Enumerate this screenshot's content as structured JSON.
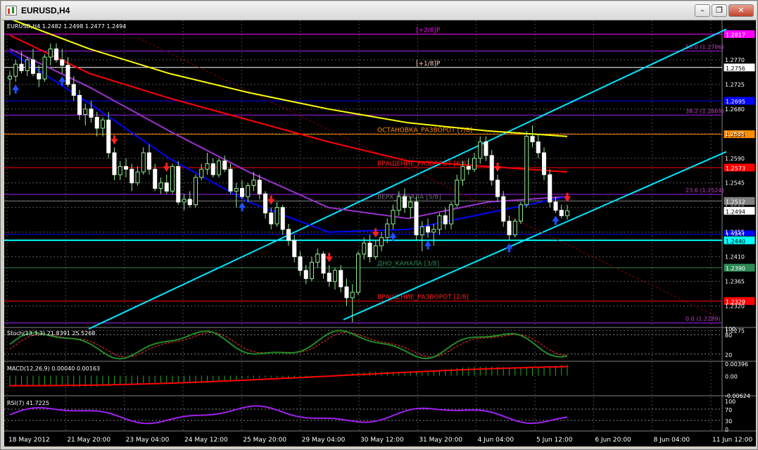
{
  "window": {
    "title": "EURUSD,H4",
    "minimize_label": "–",
    "restore_label": "❐",
    "close_label": "✕"
  },
  "chart_data": {
    "type": "candlestick",
    "symbol_header": "EURUSD,H4  1.2482 1.2498 1.2477 1.2494",
    "ylim": [
      1.2282,
      1.2842
    ],
    "y_ticks": [
      "1.2770",
      "1.2725",
      "1.2680",
      "1.2635",
      "1.2590",
      "1.2545",
      "1.2500",
      "1.2455",
      "1.2410",
      "1.2365",
      "1.2320",
      "1.2275"
    ],
    "x_ticks": [
      "18 May 2012",
      "21 May 20:00",
      "23 May 04:00",
      "24 May 12:00",
      "25 May 20:00",
      "29 May 04:00",
      "30 May 12:00",
      "31 May 20:00",
      "4 Jun 04:00",
      "5 Jun 12:00",
      "6 Jun 20:00",
      "8 Jun 04:00",
      "11 Jun 12:00"
    ],
    "levels": [
      {
        "price": 1.2817,
        "badge": "1.2817",
        "color": "#ff00ff",
        "label": "[+2/8]P",
        "label_color": "#ff00ff"
      },
      {
        "price": 1.2786,
        "badge": "",
        "color": "#a020f0",
        "label": "50.0 (1.2786)",
        "label_color": "#c040c0"
      },
      {
        "price": 1.2756,
        "badge": "1.2756",
        "color": "#ffffff",
        "label": "[+1/8]P",
        "label_color": "#ffd0c0"
      },
      {
        "price": 1.2695,
        "badge": "1.2695",
        "color": "#0000ff",
        "label": "",
        "label_color": "#0000ff"
      },
      {
        "price": 1.2669,
        "badge": "",
        "color": "#a020f0",
        "label": "38.2 (1.2669)",
        "label_color": "#c040c0"
      },
      {
        "price": 1.2634,
        "badge": "1.2634",
        "color": "#ff8c00",
        "label": "ОСТАНОВКА_РАЗВОРОТ [7/8]",
        "label_color": "#ff8c00"
      },
      {
        "price": 1.2573,
        "badge": "1.2573",
        "color": "#ff0000",
        "label": "ВРАЩЕНИЕ_РАЗВОРОТ [6/8]",
        "label_color": "#ff2020"
      },
      {
        "price": 1.2524,
        "badge": "",
        "color": "#a020f0",
        "label": "23.6 (1.2524)",
        "label_color": "#c040c0"
      },
      {
        "price": 1.2512,
        "badge": "1.2512",
        "color": "#808080",
        "label": "ВЕРХ_КАНАЛА [5/8]",
        "label_color": "#707070"
      },
      {
        "price": 1.2451,
        "badge": "1.2451",
        "color": "#0000ff",
        "label": "",
        "label_color": "#0000ff"
      },
      {
        "price": 1.244,
        "badge": "1.2440",
        "color": "#00ffff",
        "label": "",
        "label_color": "#00ffff"
      },
      {
        "price": 1.239,
        "badge": "1.2390",
        "color": "#2e8b57",
        "label": "ДНО_КАНАЛА [3/8]",
        "label_color": "#2e8b57"
      },
      {
        "price": 1.2329,
        "badge": "1.2329",
        "color": "#ff0000",
        "label": "ВРАЩЕНИЕ_РАЗВОРОТ [2/8]",
        "label_color": "#ff2020"
      },
      {
        "price": 1.2289,
        "badge": "",
        "color": "#a020f0",
        "label": "0.0 (1.2289)",
        "label_color": "#c040c0"
      }
    ],
    "current_price": "1.2494",
    "candles": [
      [
        1.2735,
        1.275,
        1.2705,
        1.274
      ],
      [
        1.274,
        1.277,
        1.273,
        1.2762
      ],
      [
        1.2762,
        1.2785,
        1.2745,
        1.275
      ],
      [
        1.275,
        1.2775,
        1.274,
        1.277
      ],
      [
        1.277,
        1.279,
        1.274,
        1.2745
      ],
      [
        1.2745,
        1.276,
        1.272,
        1.2735
      ],
      [
        1.2735,
        1.278,
        1.273,
        1.2775
      ],
      [
        1.2775,
        1.28,
        1.276,
        1.279
      ],
      [
        1.279,
        1.28,
        1.2765,
        1.277
      ],
      [
        1.277,
        1.279,
        1.2745,
        1.276
      ],
      [
        1.276,
        1.2775,
        1.272,
        1.2725
      ],
      [
        1.2725,
        1.274,
        1.2695,
        1.2705
      ],
      [
        1.2705,
        1.2715,
        1.266,
        1.267
      ],
      [
        1.267,
        1.269,
        1.265,
        1.268
      ],
      [
        1.268,
        1.2695,
        1.2655,
        1.2665
      ],
      [
        1.2665,
        1.2675,
        1.263,
        1.2645
      ],
      [
        1.2645,
        1.2665,
        1.263,
        1.266
      ],
      [
        1.266,
        1.2675,
        1.259,
        1.26
      ],
      [
        1.26,
        1.261,
        1.255,
        1.256
      ],
      [
        1.256,
        1.2585,
        1.255,
        1.2575
      ],
      [
        1.2575,
        1.259,
        1.2555,
        1.257
      ],
      [
        1.257,
        1.258,
        1.253,
        1.2545
      ],
      [
        1.2545,
        1.2575,
        1.254,
        1.2565
      ],
      [
        1.2565,
        1.261,
        1.256,
        1.26
      ],
      [
        1.26,
        1.2615,
        1.256,
        1.257
      ],
      [
        1.257,
        1.258,
        1.253,
        1.2535
      ],
      [
        1.2535,
        1.2555,
        1.2525,
        1.2545
      ],
      [
        1.2545,
        1.256,
        1.2525,
        1.253
      ],
      [
        1.253,
        1.258,
        1.2525,
        1.2575
      ],
      [
        1.2575,
        1.2585,
        1.2505,
        1.251
      ],
      [
        1.251,
        1.2525,
        1.2495,
        1.2515
      ],
      [
        1.2515,
        1.253,
        1.25,
        1.2505
      ],
      [
        1.2505,
        1.256,
        1.25,
        1.2555
      ],
      [
        1.2555,
        1.258,
        1.255,
        1.257
      ],
      [
        1.257,
        1.26,
        1.256,
        1.258
      ],
      [
        1.258,
        1.259,
        1.2555,
        1.256
      ],
      [
        1.256,
        1.259,
        1.2555,
        1.2585
      ],
      [
        1.2585,
        1.2595,
        1.2565,
        1.257
      ],
      [
        1.257,
        1.258,
        1.2525,
        1.253
      ],
      [
        1.253,
        1.2545,
        1.25,
        1.2535
      ],
      [
        1.2535,
        1.255,
        1.2515,
        1.252
      ],
      [
        1.252,
        1.2545,
        1.251,
        1.254
      ],
      [
        1.254,
        1.2565,
        1.253,
        1.255
      ],
      [
        1.255,
        1.256,
        1.2515,
        1.2525
      ],
      [
        1.2525,
        1.253,
        1.248,
        1.249
      ],
      [
        1.249,
        1.25,
        1.246,
        1.247
      ],
      [
        1.247,
        1.251,
        1.2465,
        1.25
      ],
      [
        1.25,
        1.2505,
        1.245,
        1.246
      ],
      [
        1.246,
        1.247,
        1.243,
        1.244
      ],
      [
        1.244,
        1.245,
        1.24,
        1.241
      ],
      [
        1.241,
        1.242,
        1.2375,
        1.2385
      ],
      [
        1.2385,
        1.2395,
        1.236,
        1.237
      ],
      [
        1.237,
        1.241,
        1.2365,
        1.24
      ],
      [
        1.24,
        1.2425,
        1.239,
        1.2415
      ],
      [
        1.2415,
        1.242,
        1.237,
        1.238
      ],
      [
        1.238,
        1.2395,
        1.2355,
        1.2365
      ],
      [
        1.2365,
        1.239,
        1.235,
        1.2385
      ],
      [
        1.2385,
        1.2395,
        1.2345,
        1.2355
      ],
      [
        1.2355,
        1.237,
        1.232,
        1.2335
      ],
      [
        1.2335,
        1.236,
        1.229,
        1.2345
      ],
      [
        1.2345,
        1.242,
        1.234,
        1.2415
      ],
      [
        1.2415,
        1.2445,
        1.2405,
        1.2435
      ],
      [
        1.2435,
        1.245,
        1.24,
        1.241
      ],
      [
        1.241,
        1.244,
        1.2405,
        1.243
      ],
      [
        1.243,
        1.2455,
        1.242,
        1.2445
      ],
      [
        1.2445,
        1.248,
        1.2435,
        1.247
      ],
      [
        1.247,
        1.2505,
        1.246,
        1.2495
      ],
      [
        1.2495,
        1.253,
        1.2485,
        1.252
      ],
      [
        1.252,
        1.2535,
        1.249,
        1.25
      ],
      [
        1.25,
        1.252,
        1.248,
        1.251
      ],
      [
        1.251,
        1.252,
        1.244,
        1.245
      ],
      [
        1.245,
        1.2475,
        1.242,
        1.2465
      ],
      [
        1.2465,
        1.248,
        1.2445,
        1.2455
      ],
      [
        1.2455,
        1.247,
        1.243,
        1.246
      ],
      [
        1.246,
        1.249,
        1.245,
        1.2485
      ],
      [
        1.2485,
        1.25,
        1.246,
        1.247
      ],
      [
        1.247,
        1.251,
        1.246,
        1.2505
      ],
      [
        1.2505,
        1.256,
        1.25,
        1.255
      ],
      [
        1.255,
        1.2585,
        1.254,
        1.2575
      ],
      [
        1.2575,
        1.259,
        1.256,
        1.257
      ],
      [
        1.257,
        1.26,
        1.2565,
        1.259
      ],
      [
        1.259,
        1.263,
        1.258,
        1.262
      ],
      [
        1.262,
        1.263,
        1.2585,
        1.2595
      ],
      [
        1.2595,
        1.2605,
        1.254,
        1.255
      ],
      [
        1.255,
        1.256,
        1.251,
        1.252
      ],
      [
        1.252,
        1.253,
        1.2465,
        1.2475
      ],
      [
        1.2475,
        1.2485,
        1.244,
        1.245
      ],
      [
        1.245,
        1.248,
        1.2445,
        1.2475
      ],
      [
        1.2475,
        1.251,
        1.247,
        1.2505
      ],
      [
        1.2505,
        1.264,
        1.25,
        1.263
      ],
      [
        1.263,
        1.265,
        1.261,
        1.262
      ],
      [
        1.262,
        1.2635,
        1.259,
        1.26
      ],
      [
        1.26,
        1.261,
        1.255,
        1.256
      ],
      [
        1.256,
        1.257,
        1.25,
        1.251
      ],
      [
        1.251,
        1.252,
        1.249,
        1.2495
      ],
      [
        1.2495,
        1.2505,
        1.248,
        1.2485
      ],
      [
        1.2485,
        1.2505,
        1.2478,
        1.2494
      ]
    ],
    "moving_averages": [
      {
        "color": "#ffff00",
        "values": [
          1.2845,
          1.279,
          1.2745,
          1.271,
          1.268,
          1.2655,
          1.264,
          1.263
        ]
      },
      {
        "color": "#ff0000",
        "values": [
          1.2815,
          1.2745,
          1.27,
          1.266,
          1.262,
          1.2585,
          1.2575,
          1.2565
        ]
      },
      {
        "color": "#9932cc",
        "values": [
          1.279,
          1.272,
          1.264,
          1.2565,
          1.25,
          1.248,
          1.251,
          1.252
        ]
      },
      {
        "color": "#0000ff",
        "values": [
          1.2785,
          1.269,
          1.259,
          1.251,
          1.2455,
          1.246,
          1.249,
          1.252
        ]
      }
    ],
    "signal_arrows": [
      {
        "index": 18,
        "dir": "down"
      },
      {
        "index": 27,
        "dir": "down"
      },
      {
        "index": 45,
        "dir": "down"
      },
      {
        "index": 55,
        "dir": "down"
      },
      {
        "index": 63,
        "dir": "down"
      },
      {
        "index": 84,
        "dir": "down"
      },
      {
        "index": 96,
        "dir": "down"
      },
      {
        "index": 1,
        "dir": "up"
      },
      {
        "index": 9,
        "dir": "up"
      },
      {
        "index": 40,
        "dir": "up"
      },
      {
        "index": 66,
        "dir": "up"
      },
      {
        "index": 72,
        "dir": "up"
      },
      {
        "index": 86,
        "dir": "up"
      },
      {
        "index": 94,
        "dir": "up"
      }
    ],
    "stochastic": {
      "label": "Stoch(13,3,3) 21.8391 25.5268",
      "ticks": [
        "100",
        "80",
        "20"
      ]
    },
    "macd": {
      "label": "MACD(12,26,9) 0.00040 0.00163",
      "ticks": [
        "0.00396",
        "0.00",
        "-0.00624"
      ]
    },
    "rsi": {
      "label": "RSI(7) 41.7225",
      "ticks": [
        "100",
        "70",
        "30",
        "0"
      ]
    }
  }
}
